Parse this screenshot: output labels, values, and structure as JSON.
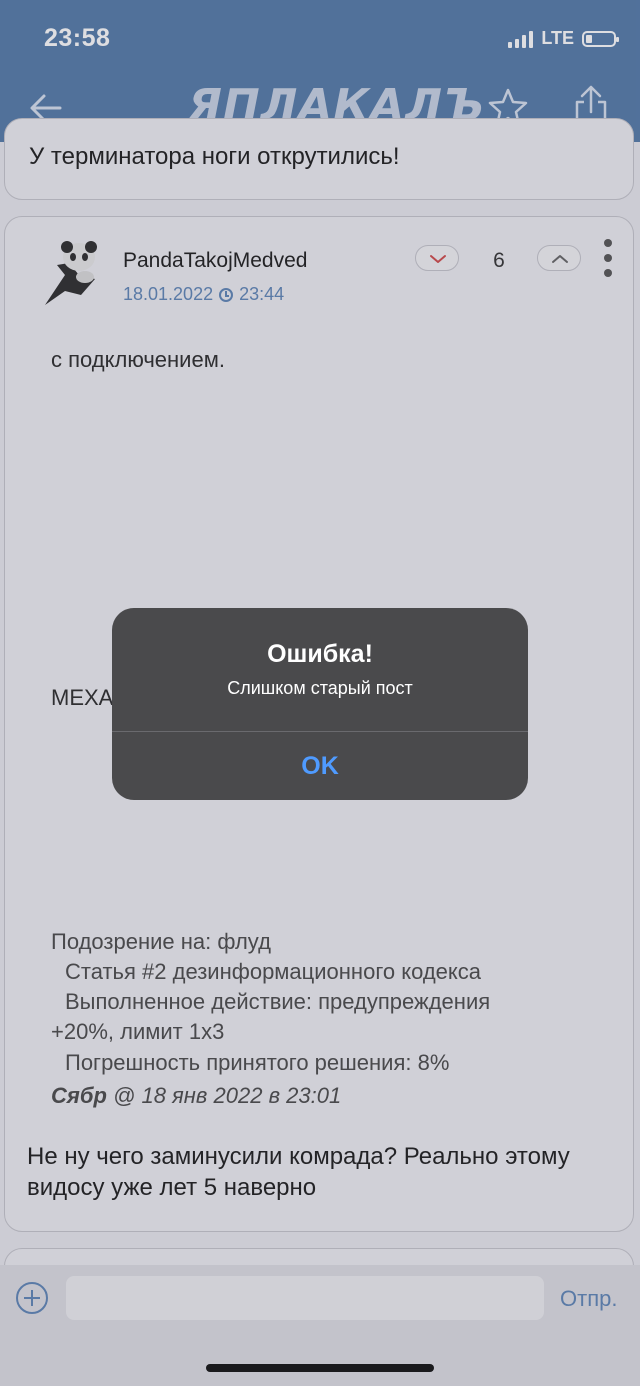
{
  "status_bar": {
    "time": "23:58",
    "network": "LTE"
  },
  "nav": {
    "logo": "ЯПЛАКАЛЪ",
    "back_icon": "back-arrow-icon",
    "favorite_icon": "star-icon",
    "share_icon": "share-icon"
  },
  "prev_post": {
    "text": "У терминатора ноги открутились!"
  },
  "post": {
    "author": "PandaTakojMedved",
    "date": "18.01.2022",
    "time": "23:44",
    "votes": "6",
    "body_lines": [
      "с подключением.",
      "MEXA"
    ],
    "moderation": {
      "suspicion": "Подозрение на: флуд",
      "article": "Статья #2 дезинформационного кодекса",
      "action": "Выполненное действие: предупреждения",
      "limit": "+20%, лимит 1x3",
      "error_margin": "Погрешность принятого решения: 8%",
      "moderator": "Сябр",
      "stamp": "@ 18 янв 2022 в 23:01"
    },
    "reply": "Не ну чего заминусили комрада? Реально этому видосу уже лет 5 наверно"
  },
  "composer": {
    "placeholder": "",
    "send_label": "Отпр."
  },
  "alert": {
    "title": "Ошибка!",
    "message": "Слишком старый пост",
    "ok_label": "OK"
  },
  "colors": {
    "nav_bar": "#547aa9",
    "accent": "#5f86b8",
    "alert_bg": "#4a4a4c",
    "alert_button": "#4f9bff"
  }
}
